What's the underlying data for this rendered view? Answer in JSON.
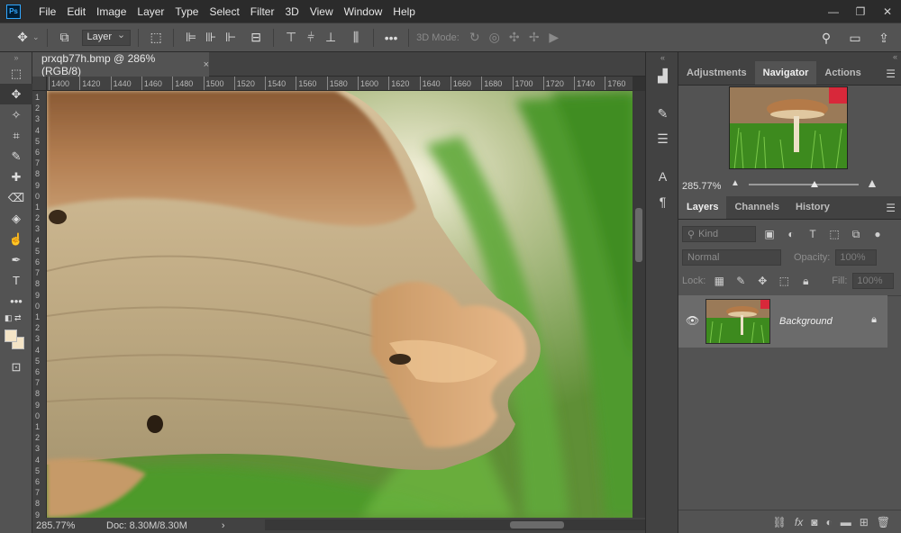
{
  "app": {
    "logo_text": "Ps"
  },
  "menu": [
    "File",
    "Edit",
    "Image",
    "Layer",
    "Type",
    "Select",
    "Filter",
    "3D",
    "View",
    "Window",
    "Help"
  ],
  "window_controls": {
    "minimize": "—",
    "restore": "❐",
    "close": "✕"
  },
  "options_bar": {
    "auto_select_value": "Layer",
    "mode_label": "3D Mode:",
    "more": "•••"
  },
  "document": {
    "tab_title": "prxqb77h.bmp @ 286% (RGB/8)",
    "tab_close": "×",
    "ruler_h_labels": [
      "1400",
      "1420",
      "1440",
      "1460",
      "1480",
      "1500",
      "1520",
      "1540",
      "1560",
      "1580",
      "1600",
      "1620",
      "1640",
      "1660",
      "1680",
      "1700",
      "1720",
      "1740",
      "1760"
    ],
    "ruler_v_labels": [
      "1",
      "2",
      "3",
      "4",
      "5",
      "6",
      "7",
      "8",
      "9",
      "0",
      "1",
      "2",
      "3",
      "4",
      "5",
      "6",
      "7",
      "8",
      "9",
      "0",
      "1",
      "2",
      "3",
      "4",
      "5",
      "6",
      "7",
      "8",
      "9",
      "0",
      "1",
      "2",
      "3",
      "4",
      "5",
      "6",
      "7",
      "8",
      "9"
    ],
    "zoom": "285.77%",
    "doc_info": "Doc: 8.30M/8.30M",
    "status_arrow": "›"
  },
  "navigator_panel": {
    "tabs": [
      "Adjustments",
      "Navigator",
      "Actions"
    ],
    "active_tab": "Navigator",
    "zoom": "285.77%",
    "slider_fraction": 0.6
  },
  "layers_panel": {
    "tabs": [
      "Layers",
      "Channels",
      "History"
    ],
    "active_tab": "Layers",
    "kind_placeholder": "Kind",
    "blend_mode": "Normal",
    "opacity_label": "Opacity:",
    "opacity_value": "100%",
    "lock_label": "Lock:",
    "fill_label": "Fill:",
    "fill_value": "100%",
    "layers": [
      {
        "name": "Background",
        "visible": true,
        "locked": true
      }
    ]
  },
  "colors": {
    "foreground": "#f4e4c6",
    "background": "#f4e4c6"
  }
}
